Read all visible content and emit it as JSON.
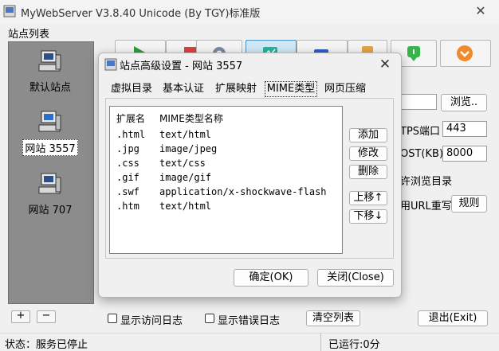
{
  "window": {
    "title": "MyWebServer V3.8.40 Unicode (By TGY)标准版",
    "close": "✕"
  },
  "sidebar": {
    "label": "站点列表",
    "sites": [
      {
        "label": "默认站点",
        "selected": false
      },
      {
        "label": "网站 3557",
        "selected": true
      },
      {
        "label": "网站 707",
        "selected": false
      }
    ],
    "add": "+",
    "remove": "−"
  },
  "toolbar": {
    "buttons": [
      {
        "icon": "play-icon",
        "color": "#2e9e3a"
      },
      {
        "icon": "stop-icon",
        "color": "#e04040"
      },
      {
        "icon": "gear-icon",
        "color": "#6f7f99"
      },
      {
        "icon": "monitor-icon",
        "color": "#25b69a"
      },
      {
        "icon": "window-icon",
        "color": "#2a5fc8"
      },
      {
        "icon": "document-icon",
        "color": "#e5a543"
      },
      {
        "icon": "info-download-icon",
        "color": "#37b54a"
      },
      {
        "icon": "chevron-circle-icon",
        "color": "#f08a2a"
      }
    ]
  },
  "settings": {
    "browse": "浏览..",
    "https_port_label": "TPS端口",
    "https_port": "443",
    "post_label": "OST(KB)",
    "post": "8000",
    "allow_browse": "许浏览目录",
    "url_rewrite": "用URL重写",
    "rules": "规则"
  },
  "bottom": {
    "show_access_log": "显示访问日志",
    "show_error_log": "显示错误日志",
    "clear_list": "清空列表",
    "exit": "退出(Exit)"
  },
  "status": {
    "left": "状态：服务已停止",
    "right": "已运行:0分"
  },
  "dialog": {
    "title": "站点高级设置 - 网站 3557",
    "close": "✕",
    "tabs": [
      "虚拟目录",
      "基本认证",
      "扩展映射",
      "MIME类型",
      "网页压缩"
    ],
    "active_tab": 3,
    "columns": [
      "扩展名",
      "MIME类型名称"
    ],
    "rows": [
      {
        "ext": ".html",
        "mime": "text/html"
      },
      {
        "ext": ".jpg",
        "mime": "image/jpeg"
      },
      {
        "ext": ".css",
        "mime": "text/css"
      },
      {
        "ext": ".gif",
        "mime": "image/gif"
      },
      {
        "ext": ".swf",
        "mime": "application/x-shockwave-flash"
      },
      {
        "ext": ".htm",
        "mime": "text/html"
      }
    ],
    "side_buttons": {
      "add": "添加",
      "edit": "修改",
      "delete": "删除",
      "up": "上移↑",
      "down": "下移↓"
    },
    "ok": "确定(OK)",
    "close_btn": "关闭(Close)"
  }
}
